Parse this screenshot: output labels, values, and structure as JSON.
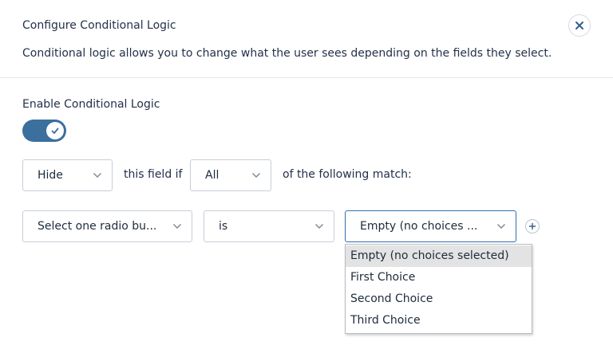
{
  "modal": {
    "title": "Configure Conditional Logic",
    "description": "Conditional logic allows you to change what the user sees depending on the fields they select."
  },
  "toggle_section": {
    "label": "Enable Conditional Logic",
    "enabled": true
  },
  "rule_header": {
    "action_value": "Hide",
    "text_middle": "this field if",
    "match_value": "All",
    "text_end": "of the following match:"
  },
  "rule": {
    "field_value": "Select one radio bu...",
    "operator_value": "is",
    "value_value": "Empty (no choices ..."
  },
  "dropdown": {
    "options": [
      "Empty (no choices selected)",
      "First Choice",
      "Second Choice",
      "Third Choice"
    ],
    "selected_index": 0
  },
  "colors": {
    "accent": "#3a6f9e",
    "focus_border": "#2f6fb0"
  }
}
